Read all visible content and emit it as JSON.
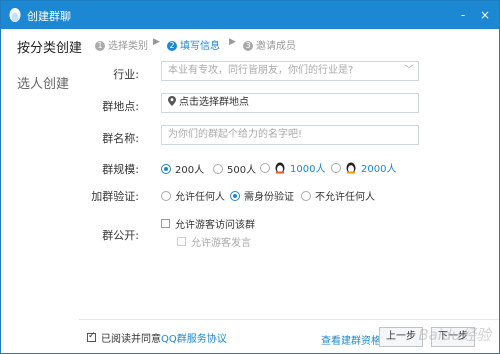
{
  "window": {
    "title": "创建群聊",
    "buttons": [
      "-",
      "×"
    ]
  },
  "sidebar": {
    "items": [
      {
        "label": "按分类创建",
        "active": true
      },
      {
        "label": "选人创建",
        "active": false
      }
    ]
  },
  "steps": [
    {
      "num": "1",
      "label": "选择类别",
      "active": false
    },
    {
      "num": "2",
      "label": "填写信息",
      "active": true
    },
    {
      "num": "3",
      "label": "邀请成员",
      "active": false
    }
  ],
  "form": {
    "industry": {
      "label": "行业:",
      "placeholder": "本业有专攻，同行皆朋友，你们的行业是?"
    },
    "location": {
      "label": "群地点:",
      "value": "点击选择群地点"
    },
    "name": {
      "label": "群名称:",
      "placeholder": "为你们的群起个给力的名字吧!"
    },
    "size": {
      "label": "群规模:",
      "options": [
        "200人",
        "500人",
        "1000人",
        "2000人"
      ],
      "selected": "200人"
    },
    "verify": {
      "label": "加群验证:",
      "options": [
        "允许任何人",
        "需身份验证",
        "不允许任何人"
      ],
      "selected": "需身份验证"
    },
    "public": {
      "label": "群公开:",
      "options": [
        "允许游客访问该群",
        "允许游客发言"
      ]
    }
  },
  "footer": {
    "agree_prefix": "已阅读并同意",
    "agree_link": "QQ群服务协议",
    "view_link": "查看建群资格",
    "prev_label": "上一步",
    "next_label": "下一步"
  },
  "watermark": "Baidu经验",
  "colors": {
    "accent": "#1c88d4",
    "titlebar": "#1c88d4"
  }
}
